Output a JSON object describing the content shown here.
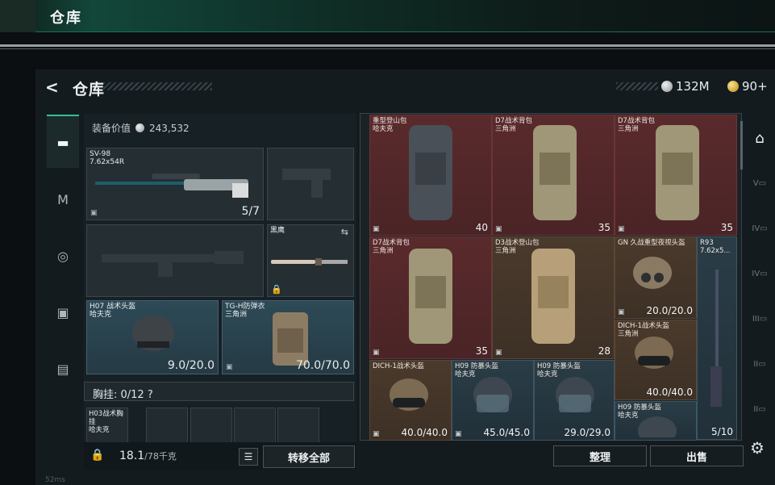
{
  "topbar": {
    "title": "仓库"
  },
  "header": {
    "back_glyph": "<",
    "title": "仓库"
  },
  "currency": [
    {
      "value": "132M",
      "icon": "silver-coin-icon"
    },
    {
      "value": "90+",
      "icon": "gold-coin-icon"
    }
  ],
  "nav_left": [
    "weapon-icon",
    "armor-icon",
    "helmet-icon",
    "backpack-icon",
    "toolbox-icon"
  ],
  "equip": {
    "label": "装备价值",
    "value": "243,532",
    "primary": {
      "name": "SV-98",
      "ammo": "7.62x54R",
      "count": "5/7"
    },
    "melee": {
      "name": "黑鹰"
    },
    "helmet": {
      "name": "H07 战术头盔",
      "origin": "哈夫克",
      "durability": "9.0/20.0"
    },
    "armor": {
      "name": "TG-H防弹衣",
      "origin": "三角洲",
      "durability": "70.0/70.0"
    },
    "chest": "胸挂: 0/12 ?",
    "rig": {
      "name": "H03战术胸挂",
      "origin": "哈夫克"
    }
  },
  "bottom": {
    "weight": "18.1",
    "capacity": "/78千克",
    "transfer_all": "转移全部"
  },
  "inventory": [
    {
      "name": "重型登山包",
      "origin": "哈夫克",
      "value": "40"
    },
    {
      "name": "D7战术背包",
      "origin": "三角洲",
      "value": "35"
    },
    {
      "name": "D7战术背包",
      "origin": "三角洲",
      "value": "35"
    },
    {
      "name": "D7战术背包",
      "origin": "三角洲",
      "value": "35"
    },
    {
      "name": "D3战术登山包",
      "origin": "三角洲",
      "value": "28"
    },
    {
      "name": "GN 久战重型夜视头盔",
      "origin": "",
      "value": "20.0/20.0"
    },
    {
      "name": "R93",
      "origin": "7.62x5...",
      "value": "5/10"
    },
    {
      "name": "DICH-1战术头盔",
      "origin": "",
      "value": "40.0/40.0"
    },
    {
      "name": "DICH-1战术头盔",
      "origin": "三角洲",
      "value": "40.0/40.0"
    },
    {
      "name": "H09 防暴头盔",
      "origin": "哈夫克",
      "value": "45.0/45.0"
    },
    {
      "name": "H09 防暴头盔",
      "origin": "哈夫克",
      "value": "29.0/29.0"
    },
    {
      "name": "H09 防暴头盔",
      "origin": "哈夫克",
      "value": ""
    }
  ],
  "actions": {
    "sort": "整理",
    "sell": "出售"
  },
  "footer": "52ms"
}
